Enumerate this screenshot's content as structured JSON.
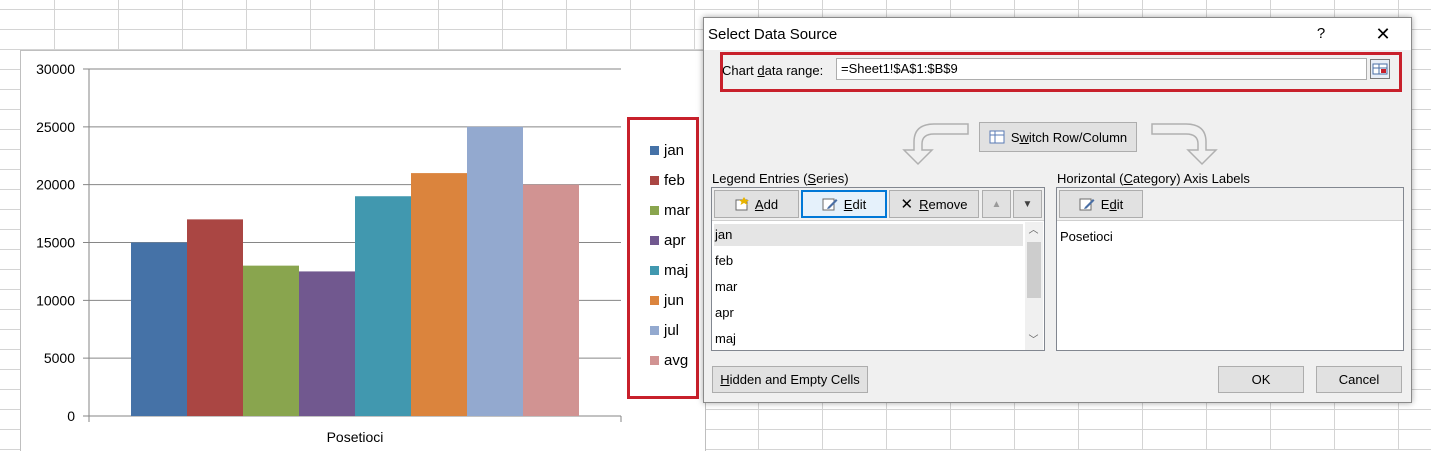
{
  "chart_data": {
    "type": "bar",
    "categories": [
      "Posetioci"
    ],
    "series": [
      {
        "name": "jan",
        "values": [
          15000
        ],
        "color": "#4572a7"
      },
      {
        "name": "feb",
        "values": [
          17000
        ],
        "color": "#aa4643"
      },
      {
        "name": "mar",
        "values": [
          13000
        ],
        "color": "#89a54e"
      },
      {
        "name": "apr",
        "values": [
          12500
        ],
        "color": "#71588f"
      },
      {
        "name": "maj",
        "values": [
          19000
        ],
        "color": "#4198af"
      },
      {
        "name": "jun",
        "values": [
          21000
        ],
        "color": "#db843d"
      },
      {
        "name": "jul",
        "values": [
          25000
        ],
        "color": "#93a9cf"
      },
      {
        "name": "avg",
        "values": [
          20000
        ],
        "color": "#d19392"
      }
    ],
    "ylim": [
      0,
      30000
    ],
    "yticks": [
      "30000",
      "25000",
      "20000",
      "15000",
      "10000",
      "5000",
      "0"
    ],
    "ytick_values": [
      30000,
      25000,
      20000,
      15000,
      10000,
      5000,
      0
    ],
    "grid": true,
    "legend": "right",
    "title": "",
    "xlabel": "",
    "ylabel": ""
  },
  "dialog": {
    "title": "Select Data Source",
    "help": "?",
    "close": "✕",
    "range_label_pre": "Chart ",
    "range_label_key": "d",
    "range_label_post": "ata range:",
    "range_value": "=Sheet1!$A$1:$B$9",
    "switch_pre": "S",
    "switch_key": "w",
    "switch_post": "itch Row/Column",
    "legend_entries_pre": "Legend Entries (",
    "legend_entries_key": "S",
    "legend_entries_post": "eries)",
    "add_key": "A",
    "add_post": "dd",
    "edit_key": "E",
    "edit_post": "dit",
    "remove_key": "R",
    "remove_post": "emove",
    "series_list": [
      "jan",
      "feb",
      "mar",
      "apr",
      "maj"
    ],
    "axis_labels_pre": "Horizontal (",
    "axis_labels_key": "C",
    "axis_labels_post": "ategory) Axis Labels",
    "axis_edit_key": "d",
    "axis_edit_pre": "E",
    "axis_edit_post": "it",
    "axis_list": [
      "Posetioci"
    ],
    "hidden_key": "H",
    "hidden_post": "idden and Empty Cells",
    "ok": "OK",
    "cancel": "Cancel"
  },
  "colors": {
    "highlight": "#c8202b",
    "focus": "#0078d7"
  }
}
